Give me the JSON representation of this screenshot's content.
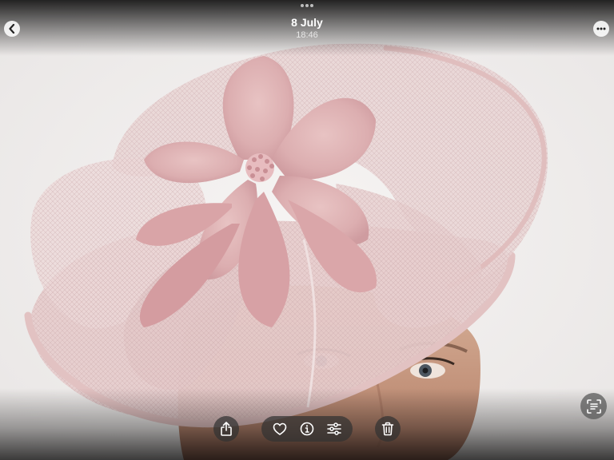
{
  "header": {
    "date": "8 July",
    "time": "18:46"
  },
  "icons": {
    "back": "chevron-left-icon",
    "more": "ellipsis-icon",
    "share": "share-icon",
    "favorite": "heart-icon",
    "info": "info-icon",
    "adjust": "sliders-icon",
    "delete": "trash-icon",
    "live_text": "live-text-icon"
  },
  "colors": {
    "hat": "#e3c6c6",
    "feather": "#d9a7aa",
    "background": "#f1efee",
    "toolbar": "#323232"
  }
}
